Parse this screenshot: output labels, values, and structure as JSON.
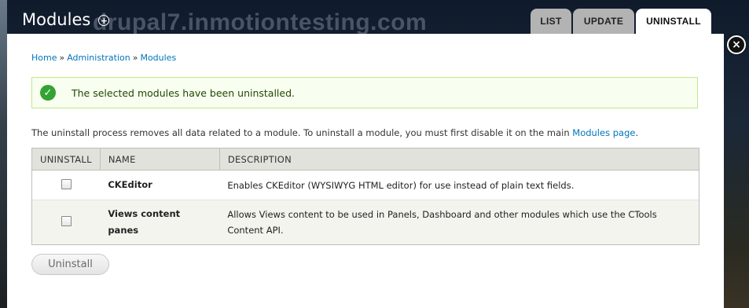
{
  "backdrop": {
    "site_name": "drupal7.inmotiontesting.com"
  },
  "overlay": {
    "title": "Modules",
    "add_icon": "plus-circle",
    "close_icon": "close-x"
  },
  "tabs": [
    {
      "label": "LIST",
      "active": false
    },
    {
      "label": "UPDATE",
      "active": false
    },
    {
      "label": "UNINSTALL",
      "active": true
    }
  ],
  "breadcrumb": {
    "items": [
      "Home",
      "Administration",
      "Modules"
    ],
    "separator": "»"
  },
  "status": {
    "message": "The selected modules have been uninstalled.",
    "icon": "check-circle",
    "color": "#33a333"
  },
  "intro": {
    "text_before": "The uninstall process removes all data related to a module. To uninstall a module, you must first disable it on the main ",
    "link_text": "Modules page",
    "text_after": "."
  },
  "table": {
    "headers": [
      "UNINSTALL",
      "NAME",
      "DESCRIPTION"
    ],
    "rows": [
      {
        "name": "CKEditor",
        "description": "Enables CKEditor (WYSIWYG HTML editor) for use instead of plain text fields.",
        "checked": false
      },
      {
        "name": "Views content panes",
        "description": "Allows Views content to be used in Panels, Dashboard and other modules which use the CTools Content API.",
        "checked": false
      }
    ]
  },
  "actions": {
    "uninstall_label": "Uninstall"
  },
  "colors": {
    "link": "#0074bd",
    "status_border": "#c2e68a",
    "status_bg": "#f8fff0"
  }
}
